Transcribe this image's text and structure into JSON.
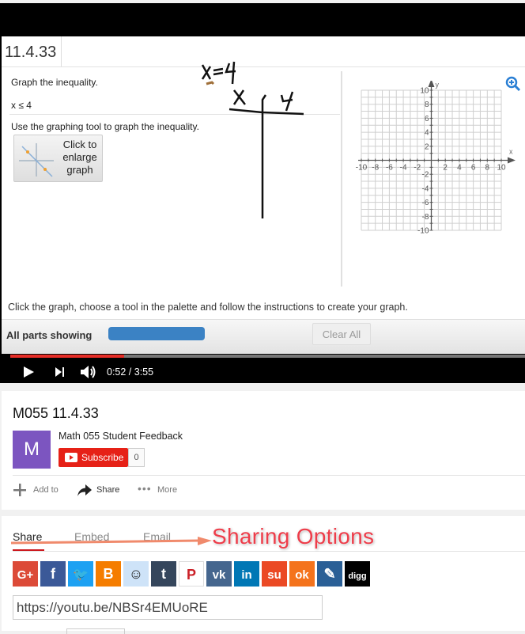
{
  "lesson": {
    "question_number": "11.4.33",
    "prompt": "Graph the inequality.",
    "inequality": "x ≤ 4",
    "tool_instruction": "Use the graphing tool to graph the inequality.",
    "enlarge_button": "Click to enlarge graph",
    "handwritten": {
      "equation": "x = 4",
      "table_col_x": "X",
      "table_col_y": "Y"
    },
    "graph": {
      "x_label": "x",
      "y_label": "y",
      "x_ticks": [
        "-10",
        "-8",
        "-6",
        "-4",
        "-2",
        "2",
        "4",
        "6",
        "8",
        "10"
      ],
      "y_ticks": [
        "10",
        "8",
        "6",
        "4",
        "2",
        "-2",
        "-4",
        "-6",
        "-8",
        "-10"
      ],
      "range": [
        -10,
        10
      ]
    },
    "bottom_instruction": "Click the graph, choose a tool in the palette and follow the instructions to create your graph.",
    "parts_label": "All parts showing",
    "clear_all": "Clear All"
  },
  "player": {
    "current_time": "0:52",
    "duration": "3:55",
    "time_display": "0:52 / 3:55",
    "progress_fraction": 0.221,
    "progress_color": "#e52d27"
  },
  "video_info": {
    "title": "M055 11.4.33",
    "channel": "Math 055 Student Feedback",
    "avatar_letter": "M",
    "avatar_color": "#7c55c0",
    "subscribe_label": "Subscribe",
    "subscriber_count": "0",
    "actions": [
      {
        "label": "Add to",
        "icon": "plus-icon"
      },
      {
        "label": "Share",
        "icon": "share-arrow-icon"
      },
      {
        "label": "More",
        "icon": "more-dots-icon"
      }
    ]
  },
  "share": {
    "tabs": [
      "Share",
      "Embed",
      "Email"
    ],
    "active_tab": "Share",
    "annotation": "Sharing Options",
    "networks": [
      {
        "name": "google-plus",
        "glyph": "G+",
        "color": "#dc4a38"
      },
      {
        "name": "facebook",
        "glyph": "f",
        "color": "#3b5998"
      },
      {
        "name": "twitter",
        "glyph": "🐦",
        "color": "#1da1f2"
      },
      {
        "name": "blogger",
        "glyph": "B",
        "color": "#f57d00"
      },
      {
        "name": "reddit",
        "glyph": "☺",
        "color": "#cee3f8"
      },
      {
        "name": "tumblr",
        "glyph": "t",
        "color": "#35465c"
      },
      {
        "name": "pinterest",
        "glyph": "P",
        "color": "#ffffff"
      },
      {
        "name": "vk",
        "glyph": "vk",
        "color": "#45668e"
      },
      {
        "name": "linkedin",
        "glyph": "in",
        "color": "#0077b5"
      },
      {
        "name": "stumbleupon",
        "glyph": "su",
        "color": "#eb4924"
      },
      {
        "name": "odnoklassniki",
        "glyph": "ok",
        "color": "#f4731c"
      },
      {
        "name": "livejournal",
        "glyph": "✎",
        "color": "#2a5f96"
      },
      {
        "name": "digg",
        "glyph": "digg",
        "color": "#000000"
      }
    ],
    "url": "https://youtu.be/NBSr4EMUoRE"
  }
}
